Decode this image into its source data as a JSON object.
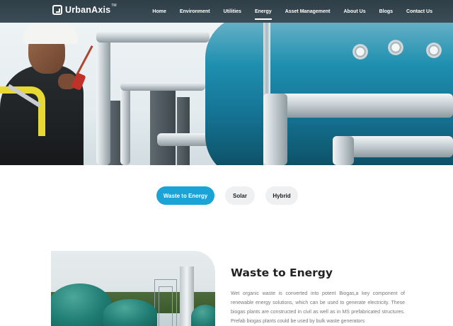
{
  "brand": {
    "name": "UrbanAxis",
    "trademark": "TM"
  },
  "nav": {
    "items": [
      {
        "label": "Home"
      },
      {
        "label": "Environment"
      },
      {
        "label": "Utilities"
      },
      {
        "label": "Energy",
        "active": true
      },
      {
        "label": "Asset Management"
      },
      {
        "label": "About Us"
      },
      {
        "label": "Blogs"
      },
      {
        "label": "Contact Us"
      }
    ]
  },
  "tabs": [
    {
      "label": "Waste to Energy",
      "active": true
    },
    {
      "label": "Solar",
      "active": false
    },
    {
      "label": "Hybrid",
      "active": false
    }
  ],
  "section": {
    "title": "Waste to Energy",
    "body": "Wet organic waste is converted into potent Biogas,a key component of renewable energy solutions, which can be used to generate electricity. These biogas plants are constructed in civil as well as in MS prefabricated structures. Prefab biogas plants could be used by bulk waste generators"
  },
  "colors": {
    "navbar": "#34444e",
    "accent": "#1aa3d6",
    "tab_inactive": "#eef0f1",
    "title": "#222222",
    "body_text": "#777777"
  },
  "icons": {
    "brand_logo": "urbanaxis-logo-icon"
  }
}
